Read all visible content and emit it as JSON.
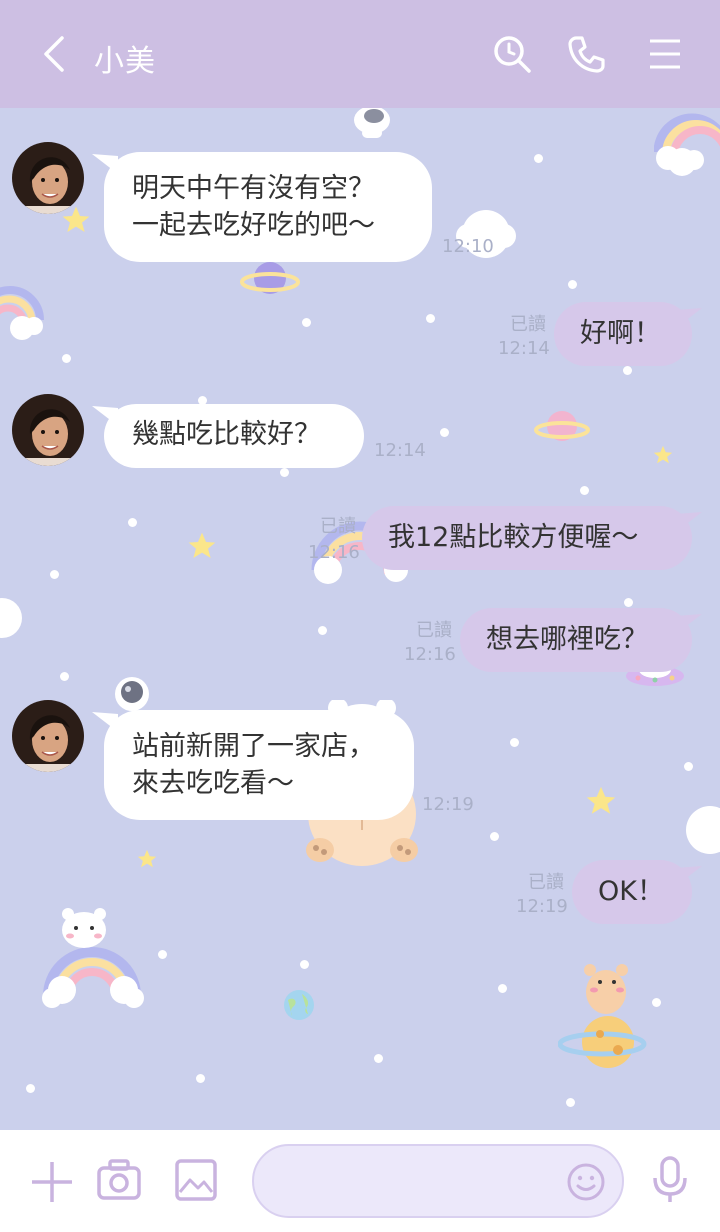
{
  "header": {
    "title": "小美",
    "icons": [
      "back-arrow-icon",
      "search-icon",
      "phone-icon",
      "menu-icon"
    ]
  },
  "theme": {
    "header_bg": "#cdbfe3",
    "chat_bg": "#cbd0ec",
    "outgoing_bubble": "#d6c8ea",
    "incoming_bubble": "#ffffff"
  },
  "messages": [
    {
      "direction": "in",
      "lines": [
        "明天中午有沒有空？",
        "一起去吃好吃的吧～"
      ],
      "time": "12:10"
    },
    {
      "direction": "out",
      "text": "好啊！",
      "read": "已讀",
      "time": "12:14"
    },
    {
      "direction": "in",
      "lines": [
        "幾點吃比較好？"
      ],
      "time": "12:14"
    },
    {
      "direction": "out",
      "text": "我12點比較方便喔～",
      "read": "已讀",
      "time": "12:16"
    },
    {
      "direction": "out",
      "text": "想去哪裡吃？",
      "read": "已讀",
      "time": "12:16"
    },
    {
      "direction": "in",
      "lines": [
        "站前新開了一家店，",
        "來去吃吃看～"
      ],
      "time": "12:19"
    },
    {
      "direction": "out",
      "text": "OK！",
      "read": "已讀",
      "time": "12:19"
    }
  ],
  "footer": {
    "icons": [
      "plus-icon",
      "camera-icon",
      "image-icon",
      "emoji-icon",
      "microphone-icon"
    ],
    "input_value": ""
  }
}
